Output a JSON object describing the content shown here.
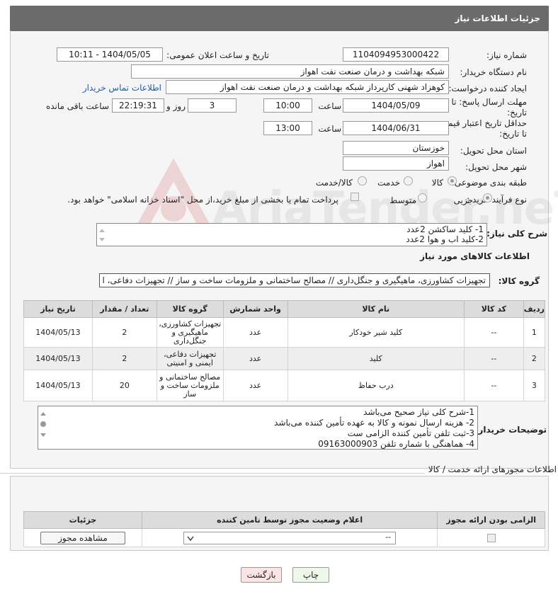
{
  "header": {
    "title": "جزئیات اطلاعات نیاز"
  },
  "form": {
    "need_number_label": "شماره نیاز:",
    "need_number": "1104094953000422",
    "announce_label": "تاریخ و ساعت اعلان عمومی:",
    "announce_value": "1404/05/05 - 10:11",
    "buyer_org_label": "نام دستگاه خریدار:",
    "buyer_org": "شبکه بهداشت و درمان صنعت نفت اهواز",
    "requester_label": "ایجاد کننده درخواست:",
    "requester": "کوهزاد شهنی کارپرداز شبکه بهداشت و درمان صنعت نفت اهواز",
    "contact_link": "اطلاعات تماس خریدار",
    "deadline_label_1": "مهلت ارسال پاسخ: تا",
    "deadline_label_2": "تاریخ:",
    "deadline_date": "1404/05/09",
    "time_label": "ساعت",
    "deadline_time": "10:00",
    "days_value": "3",
    "days_label": "روز و",
    "remaining_time": "22:19:31",
    "remaining_label": "ساعت باقی مانده",
    "validity_label_1": "حداقل تاریخ اعتبار قیمت:",
    "validity_label_2": "تا تاریخ:",
    "validity_date": "1404/06/31",
    "validity_time": "13:00",
    "province_label": "استان محل تحویل:",
    "province": "خوزستان",
    "city_label": "شهر محل تحویل:",
    "city": "اهواز",
    "category_label": "طبقه بندی موضوعی:",
    "category_options": [
      "کالا",
      "خدمت",
      "کالا/خدمت"
    ],
    "category_selected": "کالا",
    "process_label": "نوع فرآیند خرید :",
    "process_options": [
      "جزیی",
      "متوسط"
    ],
    "process_selected": "جزیی",
    "payment_note": "پرداخت تمام یا بخشی از مبلغ خرید،از محل \"اسناد خزانه اسلامی\" خواهد بود."
  },
  "description": {
    "label": "شرح کلی نیاز:",
    "lines": [
      "1- کلید ساکشن 2عدد",
      "2-کلید اب و هوا 2عدد"
    ]
  },
  "goods": {
    "section_title": "اطلاعات کالاهای مورد نیاز",
    "group_label": "گروه کالا:",
    "group_value": "تجهیزات کشاورزی، ماهیگیری و جنگل‌داری // مصالح ساختمانی و ملزومات ساخت و ساز // تجهیزات دفاعی، ا",
    "columns": [
      "ردیف",
      "کد کالا",
      "نام کالا",
      "واحد شمارش",
      "گروه کالا",
      "تعداد / مقدار",
      "تاریخ نیاز"
    ],
    "rows": [
      {
        "idx": "1",
        "code": "--",
        "name": "کلید شیر خودکار",
        "unit": "عدد",
        "group": "تجهیزات کشاورزی، ماهیگیری و جنگل‌داری",
        "qty": "2",
        "date": "1404/05/13"
      },
      {
        "idx": "2",
        "code": "--",
        "name": "کلید",
        "unit": "عدد",
        "group": "تجهیزات دفاعی، ایمنی و امنیتی",
        "qty": "2",
        "date": "1404/05/13"
      },
      {
        "idx": "3",
        "code": "--",
        "name": "درب حفاظ",
        "unit": "عدد",
        "group": "مصالح ساختمانی و ملزومات ساخت و ساز",
        "qty": "20",
        "date": "1404/05/13"
      }
    ]
  },
  "buyer_notes": {
    "label": "توضیحات خریدار:",
    "lines": [
      "1-شرح کلی نیاز صحیح می‌باشد",
      "2- هزینه ارسال نمونه و کالا به عهده تأمین کننده می‌باشد",
      "3-ثبت تلفن تأمین کننده الزامی ست",
      "4- هماهنگی با شماره تلفن 09163000903"
    ]
  },
  "permits": {
    "section_title": "اطلاعات مجوزهای ارائه خدمت / کالا",
    "columns": [
      "الزامی بودن ارائه مجوز",
      "اعلام وضعیت مجوز توسط تامین کننده",
      "جزئیات"
    ],
    "select_value": "--",
    "view_button": "مشاهده مجوز"
  },
  "actions": {
    "print": "چاپ",
    "back": "بازگشت"
  },
  "watermark": {
    "text": "AriaTender.neT"
  }
}
